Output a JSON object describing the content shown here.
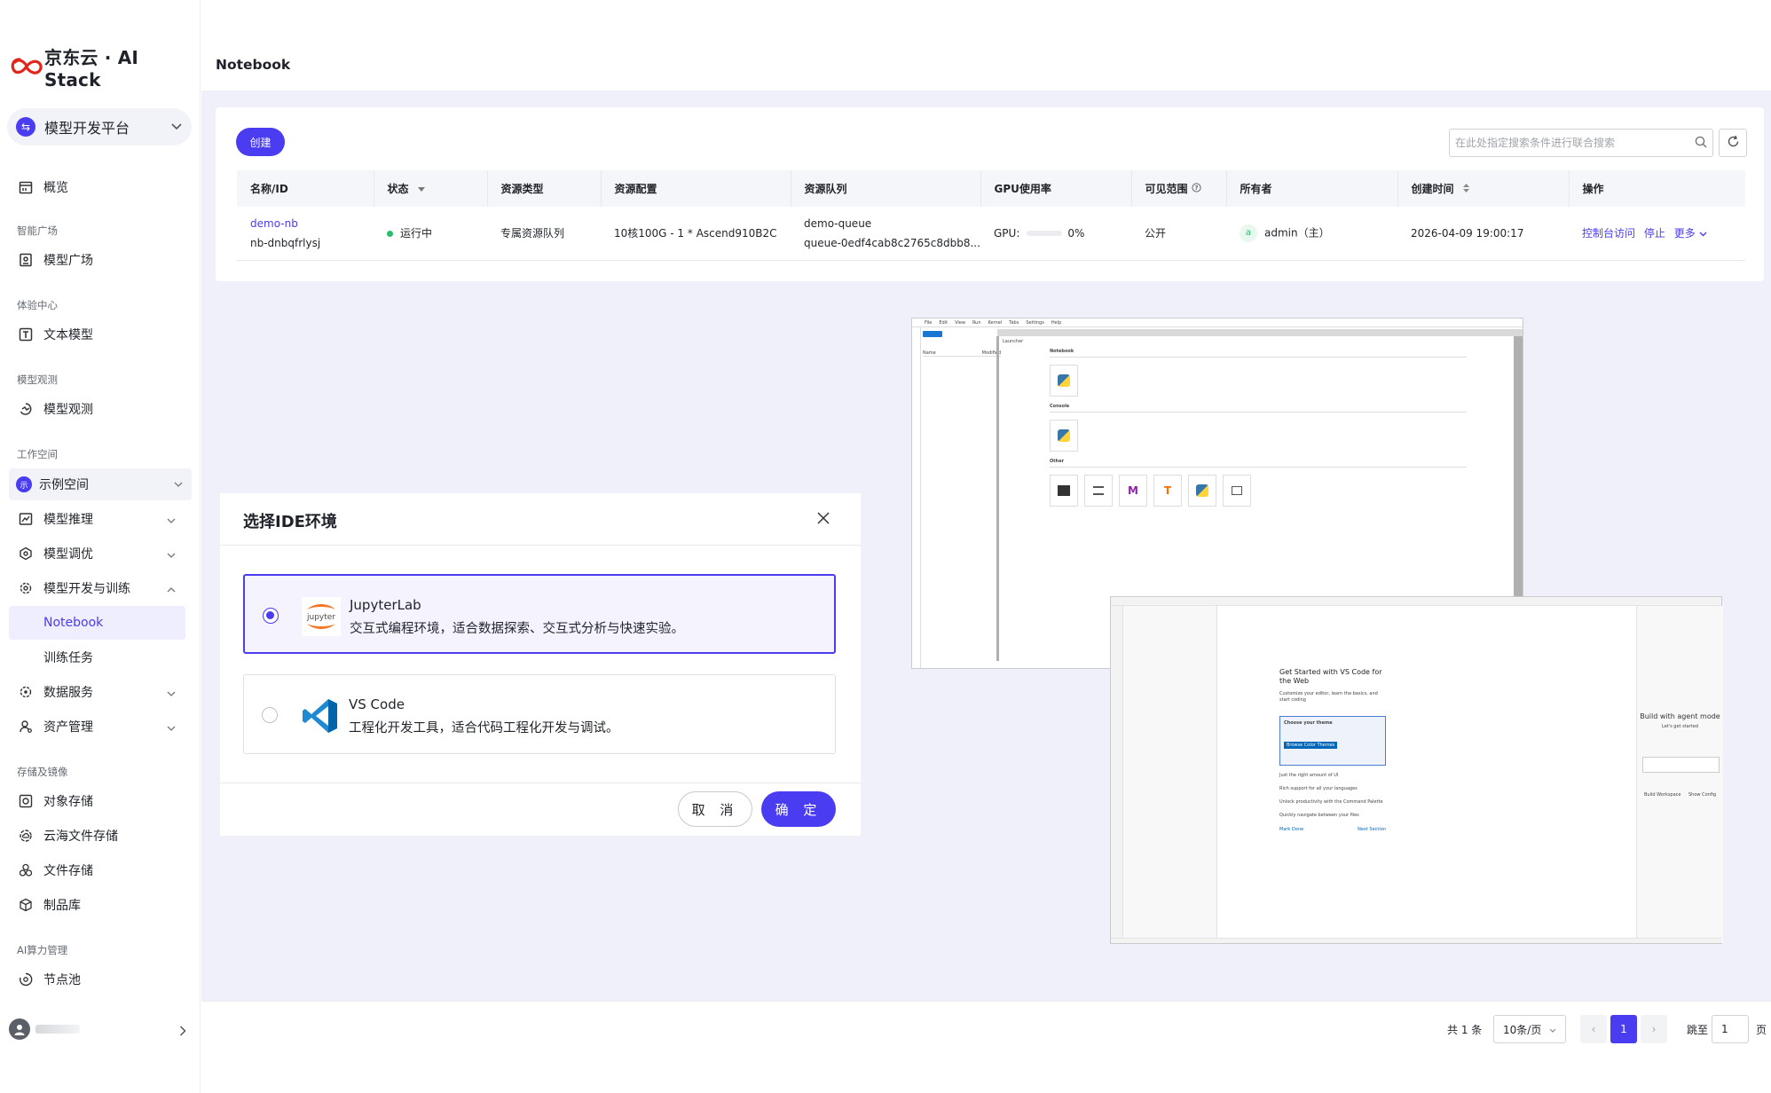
{
  "brand": {
    "logo_text": "京东云 · AI Stack"
  },
  "platform": {
    "label": "模型开发平台"
  },
  "sidebar": {
    "overview": "概览",
    "sec_market": "智能广场",
    "model_market": "模型广场",
    "sec_exp": "体验中心",
    "text_model": "文本模型",
    "sec_observe": "模型观测",
    "model_observe": "模型观测",
    "sec_workspace": "工作空间",
    "workspace": "示例空间",
    "workspace_icon": "示",
    "inference": "模型推理",
    "tuning": "模型调优",
    "dev_train": "模型开发与训练",
    "notebook": "Notebook",
    "train_task": "训练任务",
    "data_service": "数据服务",
    "asset_mgmt": "资产管理",
    "sec_storage": "存储及镜像",
    "object_storage": "对象存储",
    "cloud_fs": "云海文件存储",
    "file_storage": "文件存储",
    "artifact": "制品库",
    "sec_compute": "AI算力管理",
    "node_pool": "节点池"
  },
  "header": {
    "title": "Notebook"
  },
  "toolbar": {
    "create": "创建",
    "search_placeholder": "在此处指定搜索条件进行联合搜索"
  },
  "table": {
    "headers": [
      "名称/ID",
      "状态",
      "资源类型",
      "资源配置",
      "资源队列",
      "GPU使用率",
      "可见范围",
      "所有者",
      "创建时间",
      "操作"
    ],
    "row": {
      "name": "demo-nb",
      "id": "nb-dnbqfrlysj",
      "status": "运行中",
      "resource_type": "专属资源队列",
      "resource_config": "10核100G - 1 * Ascend910B2C",
      "queue_name": "demo-queue",
      "queue_id": "queue-0edf4cab8c2765c8dbb8...",
      "gpu_label": "GPU:",
      "gpu_value": "0%",
      "gpu_fraction": 0,
      "visibility": "公开",
      "owner_avatar": "a",
      "owner": "admin（主）",
      "created": "2026-04-09 19:00:17",
      "op_console": "控制台访问",
      "op_stop": "停止",
      "op_more": "更多"
    }
  },
  "pagination": {
    "total": "共 1 条",
    "page_size": "10条/页",
    "current": "1",
    "jump_label": "跳至",
    "jump_value": "1",
    "page_unit": "页"
  },
  "modal": {
    "title": "选择IDE环境",
    "options": [
      {
        "name": "JupyterLab",
        "desc": "交互式编程环境，适合数据探索、交互式分析与快速实验。",
        "logo_text": "jupyter"
      },
      {
        "name": "VS Code",
        "desc": "工程化开发工具，适合代码工程化开发与调试。"
      }
    ],
    "cancel": "取 消",
    "ok": "确 定"
  },
  "preview_jupyter": {
    "menu": [
      "File",
      "Edit",
      "View",
      "Run",
      "Kernel",
      "Tabs",
      "Settings",
      "Help"
    ],
    "tab": "Launcher",
    "sections": [
      "Notebook",
      "Console",
      "Other"
    ],
    "python_label": "Python 3 (ipykernel)",
    "others": [
      "Terminal",
      "Text File",
      "Markdown File",
      "Tensorboard",
      "Python File",
      "Show Contextual Help"
    ],
    "file_cols": [
      "Name",
      "Modified"
    ]
  },
  "preview_vscode": {
    "title": "Get Started with VS Code for the Web",
    "subtitle": "Customize your editor, learn the basics, and start coding",
    "steps": [
      "Choose your theme",
      "Just the right amount of UI",
      "Rich support for all your languages",
      "Unlock productivity with the Command Palette",
      "Quickly navigate between your files"
    ],
    "theme_button": "Browse Color Themes",
    "agent": "Build with agent mode",
    "agent_sub": "Let's get started",
    "mark_done": "Mark Done",
    "next_section": "Next Section",
    "workspace_button": "Build Workspace",
    "config_button": "Show Config"
  },
  "colors": {
    "accent": "#4a3cf0",
    "running": "#2bbb6a",
    "bg": "#eff0fa"
  }
}
